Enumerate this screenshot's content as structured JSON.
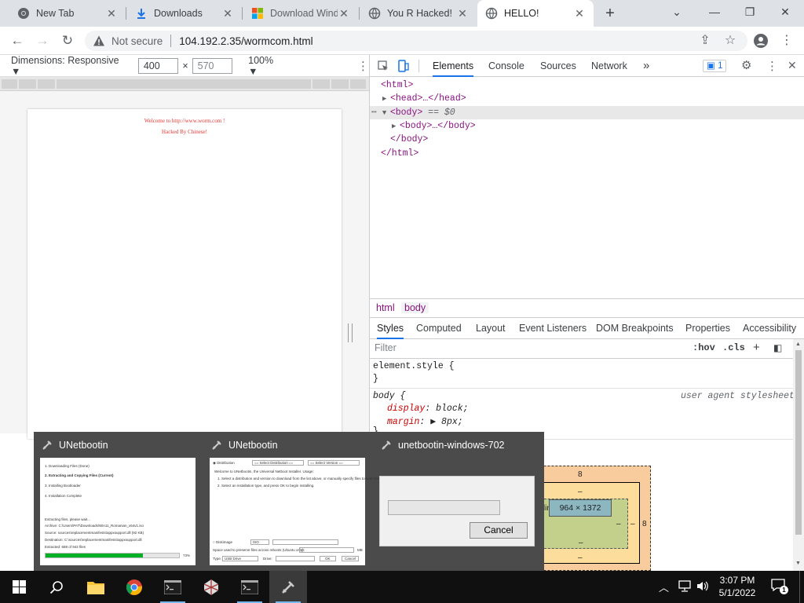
{
  "browser": {
    "tabs": [
      {
        "title": "New Tab",
        "icon": "chrome-icon"
      },
      {
        "title": "Downloads",
        "icon": "download-icon"
      },
      {
        "title": "Download Windows",
        "icon": "microsoft-icon"
      },
      {
        "title": "You R Hacked!",
        "icon": "globe-icon"
      },
      {
        "title": "HELLO!",
        "icon": "globe-icon"
      }
    ],
    "new_tab": "+",
    "window_controls": {
      "chevron": "⌄",
      "minimize": "—",
      "restore": "❐",
      "close": "✕"
    },
    "address": {
      "security_label": "Not secure",
      "url": "104.192.2.35/wormcom.html"
    }
  },
  "page": {
    "line1": "Welcome to http://www.worm.com !",
    "line2": "Hacked By Chinese!"
  },
  "device_toolbar": {
    "dimensions_label": "Dimensions: Responsive ▼",
    "width": "400",
    "times": "×",
    "height": "570",
    "zoom": "100% ▼",
    "more": "⋮"
  },
  "devtools": {
    "tabs": [
      "Elements",
      "Console",
      "Sources",
      "Network",
      "»"
    ],
    "issues_badge": "1",
    "dom": [
      {
        "text": "<html>",
        "indent": 14
      },
      {
        "text": "<head>…</head>",
        "indent": 26,
        "tri": "▶"
      },
      {
        "text": "<body>",
        "indent": 26,
        "tri": "▼",
        "suffix": " == $0",
        "selected": true
      },
      {
        "text": "<body>…</body>",
        "indent": 38,
        "tri": "▶"
      },
      {
        "text": "</body>",
        "indent": 26
      },
      {
        "text": "</html>",
        "indent": 14
      }
    ],
    "breadcrumb": [
      "html",
      "body"
    ],
    "subtabs": [
      "Styles",
      "Computed",
      "Layout",
      "Event Listeners",
      "DOM Breakpoints",
      "Properties",
      "Accessibility"
    ],
    "filter_placeholder": "Filter",
    "filter_tools": {
      "hov": ":hov",
      "cls": ".cls",
      "plus": "+"
    },
    "styles": {
      "element_style": "element.style {",
      "close_brace": "}",
      "body_selector": "body {",
      "ua_label": "user agent stylesheet",
      "props": [
        {
          "name": "display",
          "value": "block;"
        },
        {
          "name": "margin",
          "value": "▶ 8px;"
        }
      ]
    },
    "box_model": {
      "margin": "8",
      "border_label": "er",
      "border": "–",
      "padding_label": "dding",
      "padding": "–",
      "content": "964 × 1372",
      "side_left": "–",
      "side_right": "–",
      "margin_right": "8"
    }
  },
  "preview": {
    "windows": [
      {
        "title": "UNetbootin"
      },
      {
        "title": "UNetbootin"
      },
      {
        "title": "unetbootin-windows-702"
      }
    ],
    "thumb1": {
      "steps": [
        "1. Downloading Files (Done)",
        "2. Extracting and Copying Files (Current)",
        "3. Installing Bootloader",
        "4. Installation Complete"
      ],
      "status": "Extracting files, please wait...",
      "archive": "Archive: C:\\Users\\PAT\\Downloads\\Win11_Romanian_x64v1.iso",
      "source": "Source: sources\\replacementmanifests\\appxsupport.dll (92 KB)",
      "destination": "Destination: C:\\sources\\replacementmanifests\\appxsupport.dll",
      "extracted": "Extracted: 688 of 942 files",
      "progress": 0.73,
      "percent": "73%"
    },
    "thumb2": {
      "distribution": "Distribution",
      "select_distribution": "== Select Distribution ==",
      "select_version": "== Select Version ==",
      "welcome": "Welcome to UNetbootin, the Universal Netboot Installer. Usage:",
      "step1": "1. Select a distribution and version to download from the list above, or manually specify files to load below.",
      "step2": "2. Select an installation type, and press OK to begin installing.",
      "diskimage": "Diskimage",
      "iso": "ISO",
      "space_label": "Space used to preserve files across reboots (Ubuntu only):",
      "space_value": "0",
      "mb": "MB",
      "type_label": "Type:",
      "type_value": "USB Drive",
      "drive_label": "Drive:",
      "ok": "OK",
      "cancel": "Cancel"
    },
    "thumb3": {
      "cancel": "Cancel"
    }
  },
  "taskbar": {
    "clock_time": "3:07 PM",
    "clock_date": "5/1/2022",
    "notif_count": "1"
  }
}
